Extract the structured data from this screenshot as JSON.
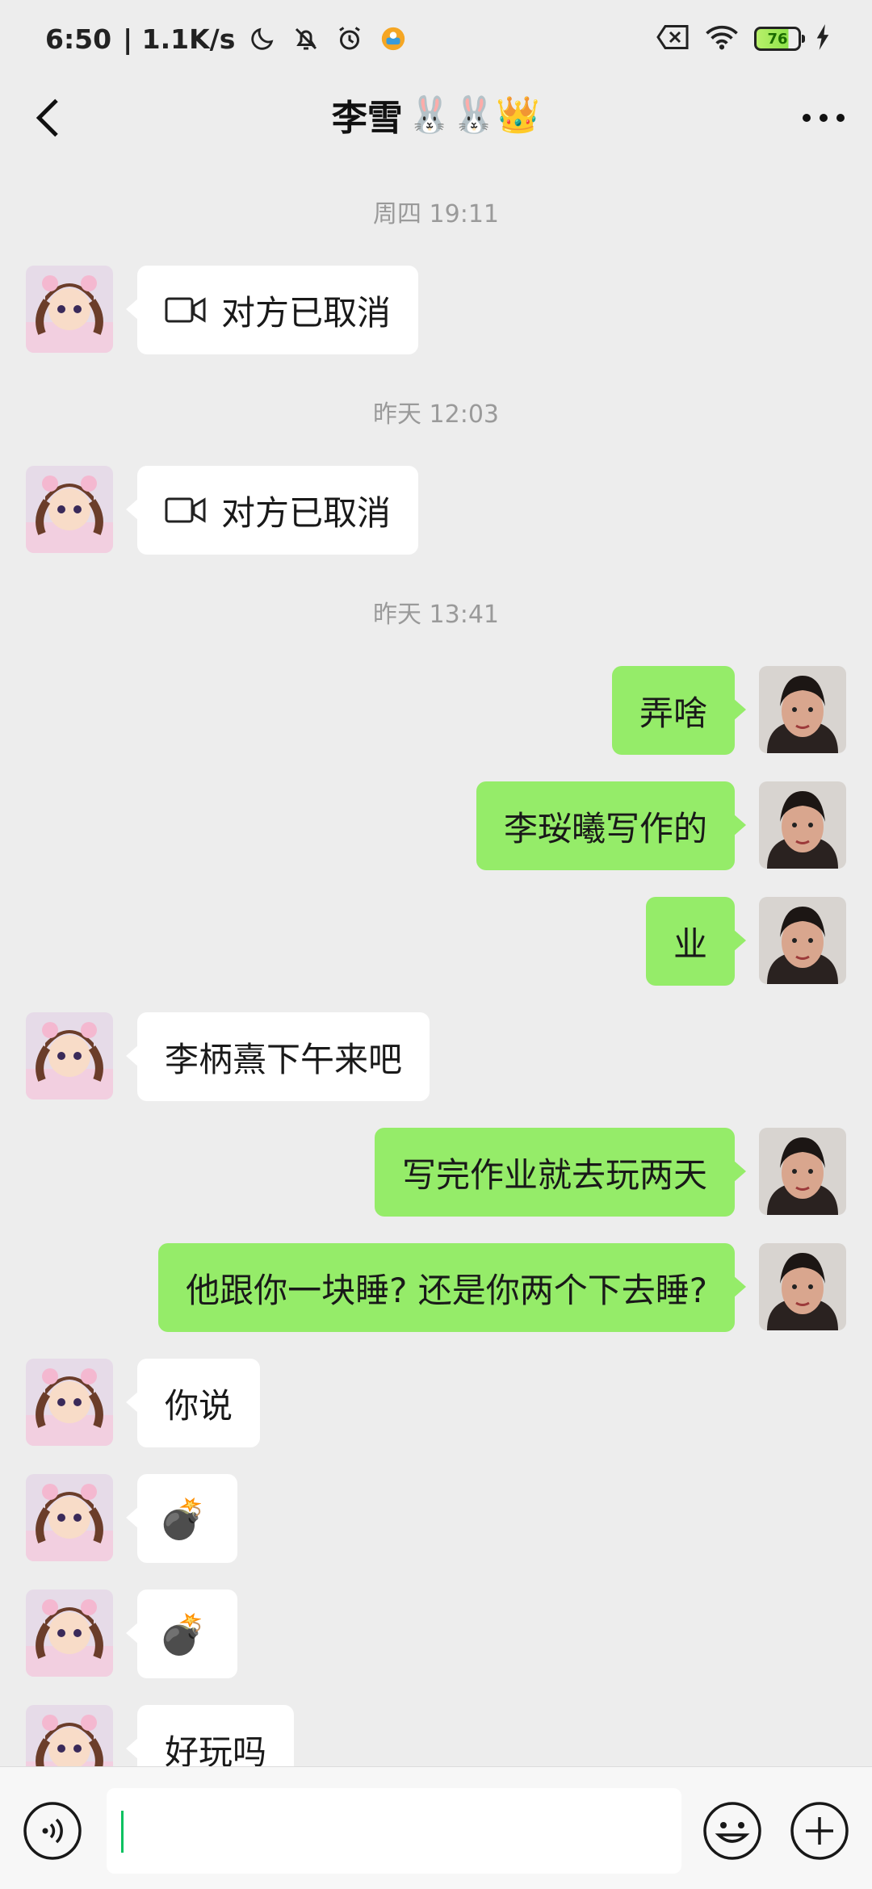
{
  "status_bar": {
    "time": "6:50",
    "net_speed": "| 1.1K/s",
    "battery": "76"
  },
  "header": {
    "title": "李雪",
    "title_emoji": "🐰🐰👑"
  },
  "messages": {
    "ts1": "周四 19:11",
    "m1_text": "对方已取消",
    "ts2": "昨天 12:03",
    "m2_text": "对方已取消",
    "ts3": "昨天 13:41",
    "m3_text": "弄啥",
    "m4_text": "李珱曦写作的",
    "m5_text": "业",
    "m6_text": "李柄熹下午来吧",
    "m7_text": "写完作业就去玩两天",
    "m8_text": "他跟你一块睡? 还是你两个下去睡?",
    "m9_text": "你说",
    "m10_emoji": "💣",
    "m11_emoji": "💣",
    "m12_text": "好玩吗"
  },
  "icons": {
    "back": "chevron-left-icon",
    "more": "more-dots-icon",
    "video_call": "video-camera-icon",
    "voice": "voice-icon",
    "emoji": "smiley-icon",
    "plus": "plus-icon"
  },
  "colors": {
    "background": "#ededed",
    "self_bubble": "#95ec69",
    "other_bubble": "#ffffff",
    "timestamp": "#9a9a9a",
    "input_bar": "#f7f7f7",
    "caret": "#07c160"
  }
}
